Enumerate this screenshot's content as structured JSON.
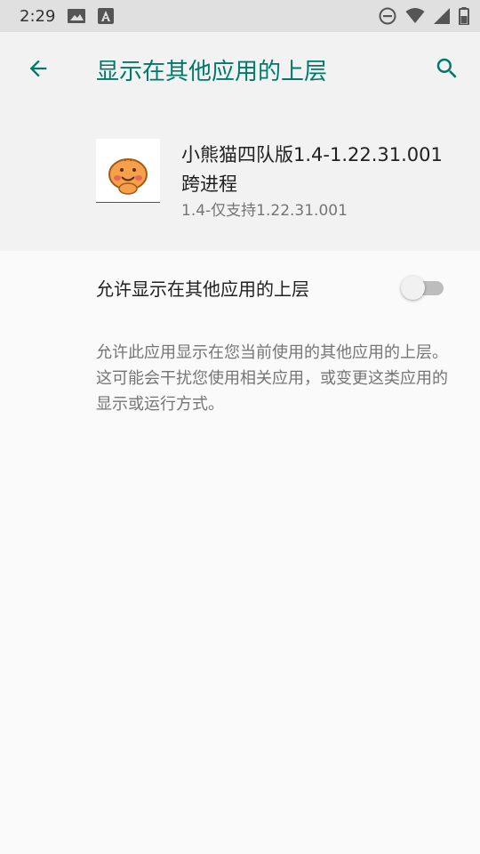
{
  "status_bar": {
    "time": "2:29",
    "icons": [
      "image-icon",
      "a-badge-icon",
      "do-not-disturb-icon",
      "wifi-icon",
      "signal-icon",
      "battery-icon"
    ]
  },
  "app_bar": {
    "title": "显示在其他应用的上层",
    "back_icon": "back-arrow-icon",
    "search_icon": "search-icon",
    "accent_color": "#00796b"
  },
  "app_info": {
    "name": "小熊猫四队版1.4-1.22.31.001 跨进程",
    "version": "1.4-仅支持1.22.31.001",
    "icon": "app-logo-icon"
  },
  "setting": {
    "label": "允许显示在其他应用的上层",
    "enabled": false
  },
  "description": "允许此应用显示在您当前使用的其他应用的上层。这可能会干扰您使用相关应用，或变更这类应用的显示或运行方式。"
}
